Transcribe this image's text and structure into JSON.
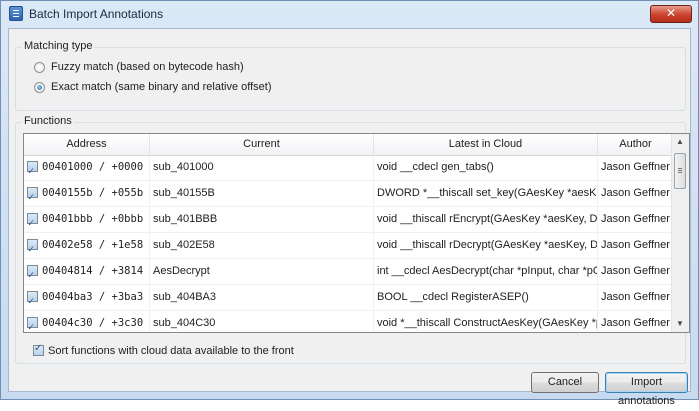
{
  "window": {
    "title": "Batch Import Annotations",
    "close_label": "✕"
  },
  "matching": {
    "label": "Matching type",
    "options": [
      {
        "label": "Fuzzy match (based on bytecode hash)",
        "selected": false
      },
      {
        "label": "Exact match (same binary and relative offset)",
        "selected": true
      }
    ]
  },
  "functions": {
    "label": "Functions",
    "columns": [
      "Address",
      "Current",
      "Latest in Cloud",
      "Author"
    ],
    "rows": [
      {
        "address": "00401000 / +0000",
        "current": "sub_401000",
        "cloud": "void __cdecl gen_tabs()",
        "author": "Jason Geffner"
      },
      {
        "address": "0040155b / +055b",
        "current": "sub_40155B",
        "cloud": "DWORD *__thiscall set_key(GAesKey *aesKey, ...",
        "author": "Jason Geffner"
      },
      {
        "address": "00401bbb / +0bbb",
        "current": "sub_401BBB",
        "cloud": "void __thiscall rEncrypt(GAesKey *aesKey, DW...",
        "author": "Jason Geffner"
      },
      {
        "address": "00402e58 / +1e58",
        "current": "sub_402E58",
        "cloud": "void __thiscall rDecrypt(GAesKey *aesKey, DW...",
        "author": "Jason Geffner"
      },
      {
        "address": "00404814 / +3814",
        "current": "AesDecrypt",
        "cloud": "int __cdecl AesDecrypt(char *pInput, char *pO...",
        "author": "Jason Geffner"
      },
      {
        "address": "00404ba3 / +3ba3",
        "current": "sub_404BA3",
        "cloud": "BOOL __cdecl RegisterASEP()",
        "author": "Jason Geffner"
      },
      {
        "address": "00404c30 / +3c30",
        "current": "sub_404C30",
        "cloud": "void *__thiscall ConstructAesKey(GAesKey *p...",
        "author": "Jason Geffner"
      }
    ]
  },
  "sort_option": {
    "label": "Sort functions with cloud data available to the front",
    "checked": true
  },
  "buttons": {
    "cancel": "Cancel",
    "import": "Import annotations"
  }
}
